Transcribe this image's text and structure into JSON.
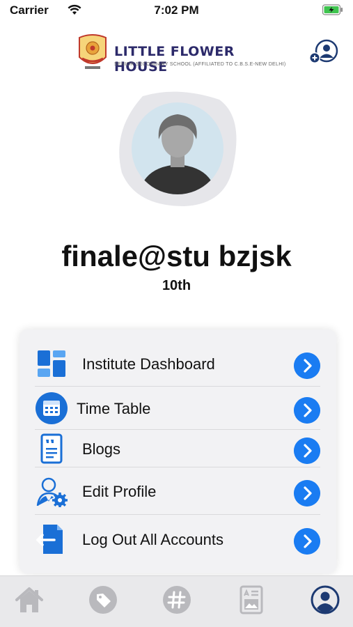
{
  "status_bar": {
    "carrier": "Carrier",
    "time": "7:02 PM"
  },
  "header": {
    "school_name": "LITTLE FLOWER HOUSE",
    "school_subtitle": "SENIOR SECONDARY SCHOOL (AFFILIATED TO C.B.S.E-NEW DELHI)"
  },
  "profile": {
    "name": "finale@stu bzjsk",
    "class": "10th"
  },
  "menu": {
    "items": [
      {
        "label": "Institute Dashboard",
        "icon": "dashboard-icon"
      },
      {
        "label": "Time Table",
        "icon": "calendar-icon"
      },
      {
        "label": "Blogs",
        "icon": "blog-icon"
      },
      {
        "label": "Edit Profile",
        "icon": "user-settings-icon"
      },
      {
        "label": "Log Out All Accounts",
        "icon": "logout-icon"
      }
    ]
  },
  "tab_bar": {
    "tabs": [
      {
        "icon": "home-icon",
        "active": false
      },
      {
        "icon": "tag-icon",
        "active": false
      },
      {
        "icon": "hashtag-icon",
        "active": false
      },
      {
        "icon": "news-icon",
        "active": false
      },
      {
        "icon": "profile-icon",
        "active": true
      }
    ]
  },
  "colors": {
    "accent": "#1a7cf2",
    "brand": "#2c2a6a",
    "tab_inactive": "#b9b9bd",
    "tab_active": "#1d3a72"
  }
}
